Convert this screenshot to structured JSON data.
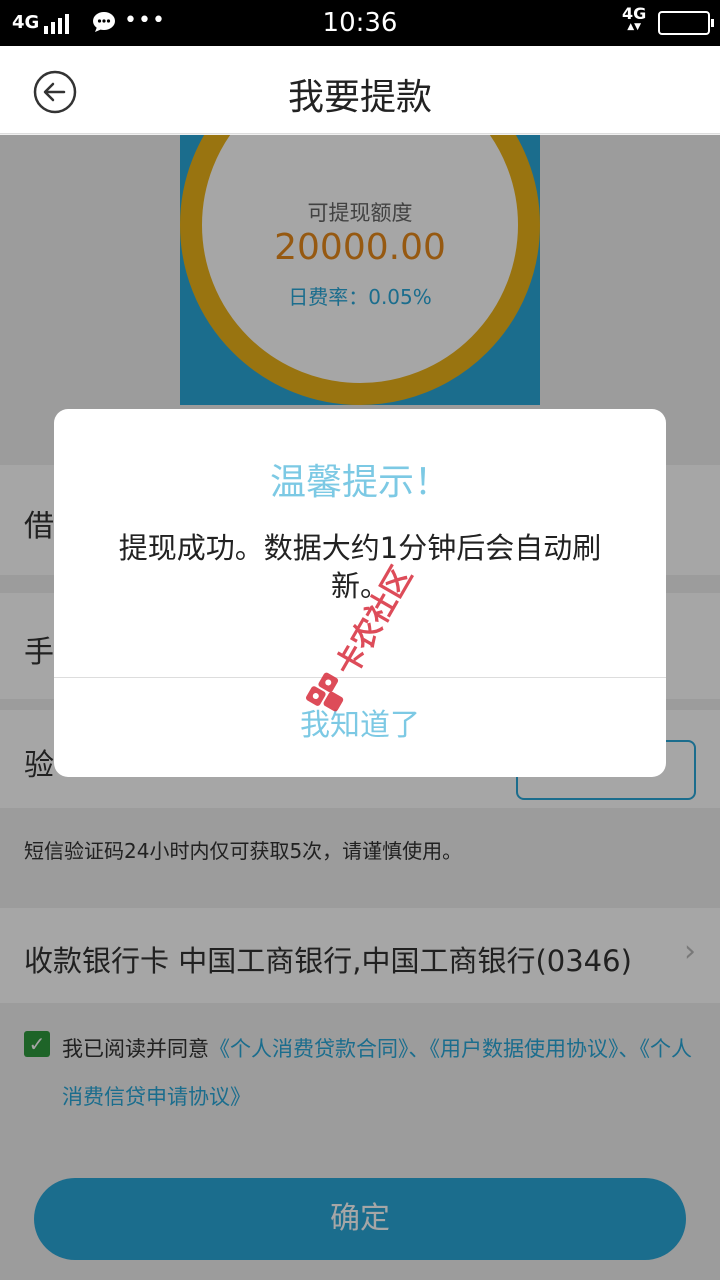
{
  "status_bar": {
    "network_left": "4G",
    "time": "10:36",
    "network_right": "4G",
    "network_right_arrows": "▲▼",
    "dots": "•••"
  },
  "header": {
    "title": "我要提款",
    "back_icon": "back-arrow-icon"
  },
  "quota": {
    "label": "可提现额度",
    "amount": "20000.00",
    "daily_rate": "日费率：0.05%"
  },
  "form": {
    "loan_label": "借",
    "phone_label": "手",
    "code_label": "验",
    "sms_note": "短信验证码24小时内仅可获取5次，请谨慎使用。",
    "bank_label": "收款银行卡",
    "bank_value": "中国工商银行,中国工商银行(0346)",
    "bank_chevron": "›"
  },
  "agreement": {
    "checked": true,
    "check_mark": "✓",
    "prefix": "我已阅读并同意",
    "link1": "《个人消费贷款合同》",
    "sep1": "、",
    "link2": "《用户数据使用协议》",
    "sep2": "、",
    "link3": "《个人消费信贷申请协议》"
  },
  "confirm_button": "确定",
  "modal": {
    "title": "温馨提示！",
    "message": "提现成功。数据大约1分钟后会自动刷新。",
    "ok": "我知道了"
  },
  "watermark": {
    "text": "卡农社区"
  },
  "colors": {
    "accent": "#2aa8d9",
    "ring": "#ecb31a",
    "amount": "#e6891b",
    "modal_accent": "#7cc9e4",
    "check": "#2e9a3e"
  }
}
